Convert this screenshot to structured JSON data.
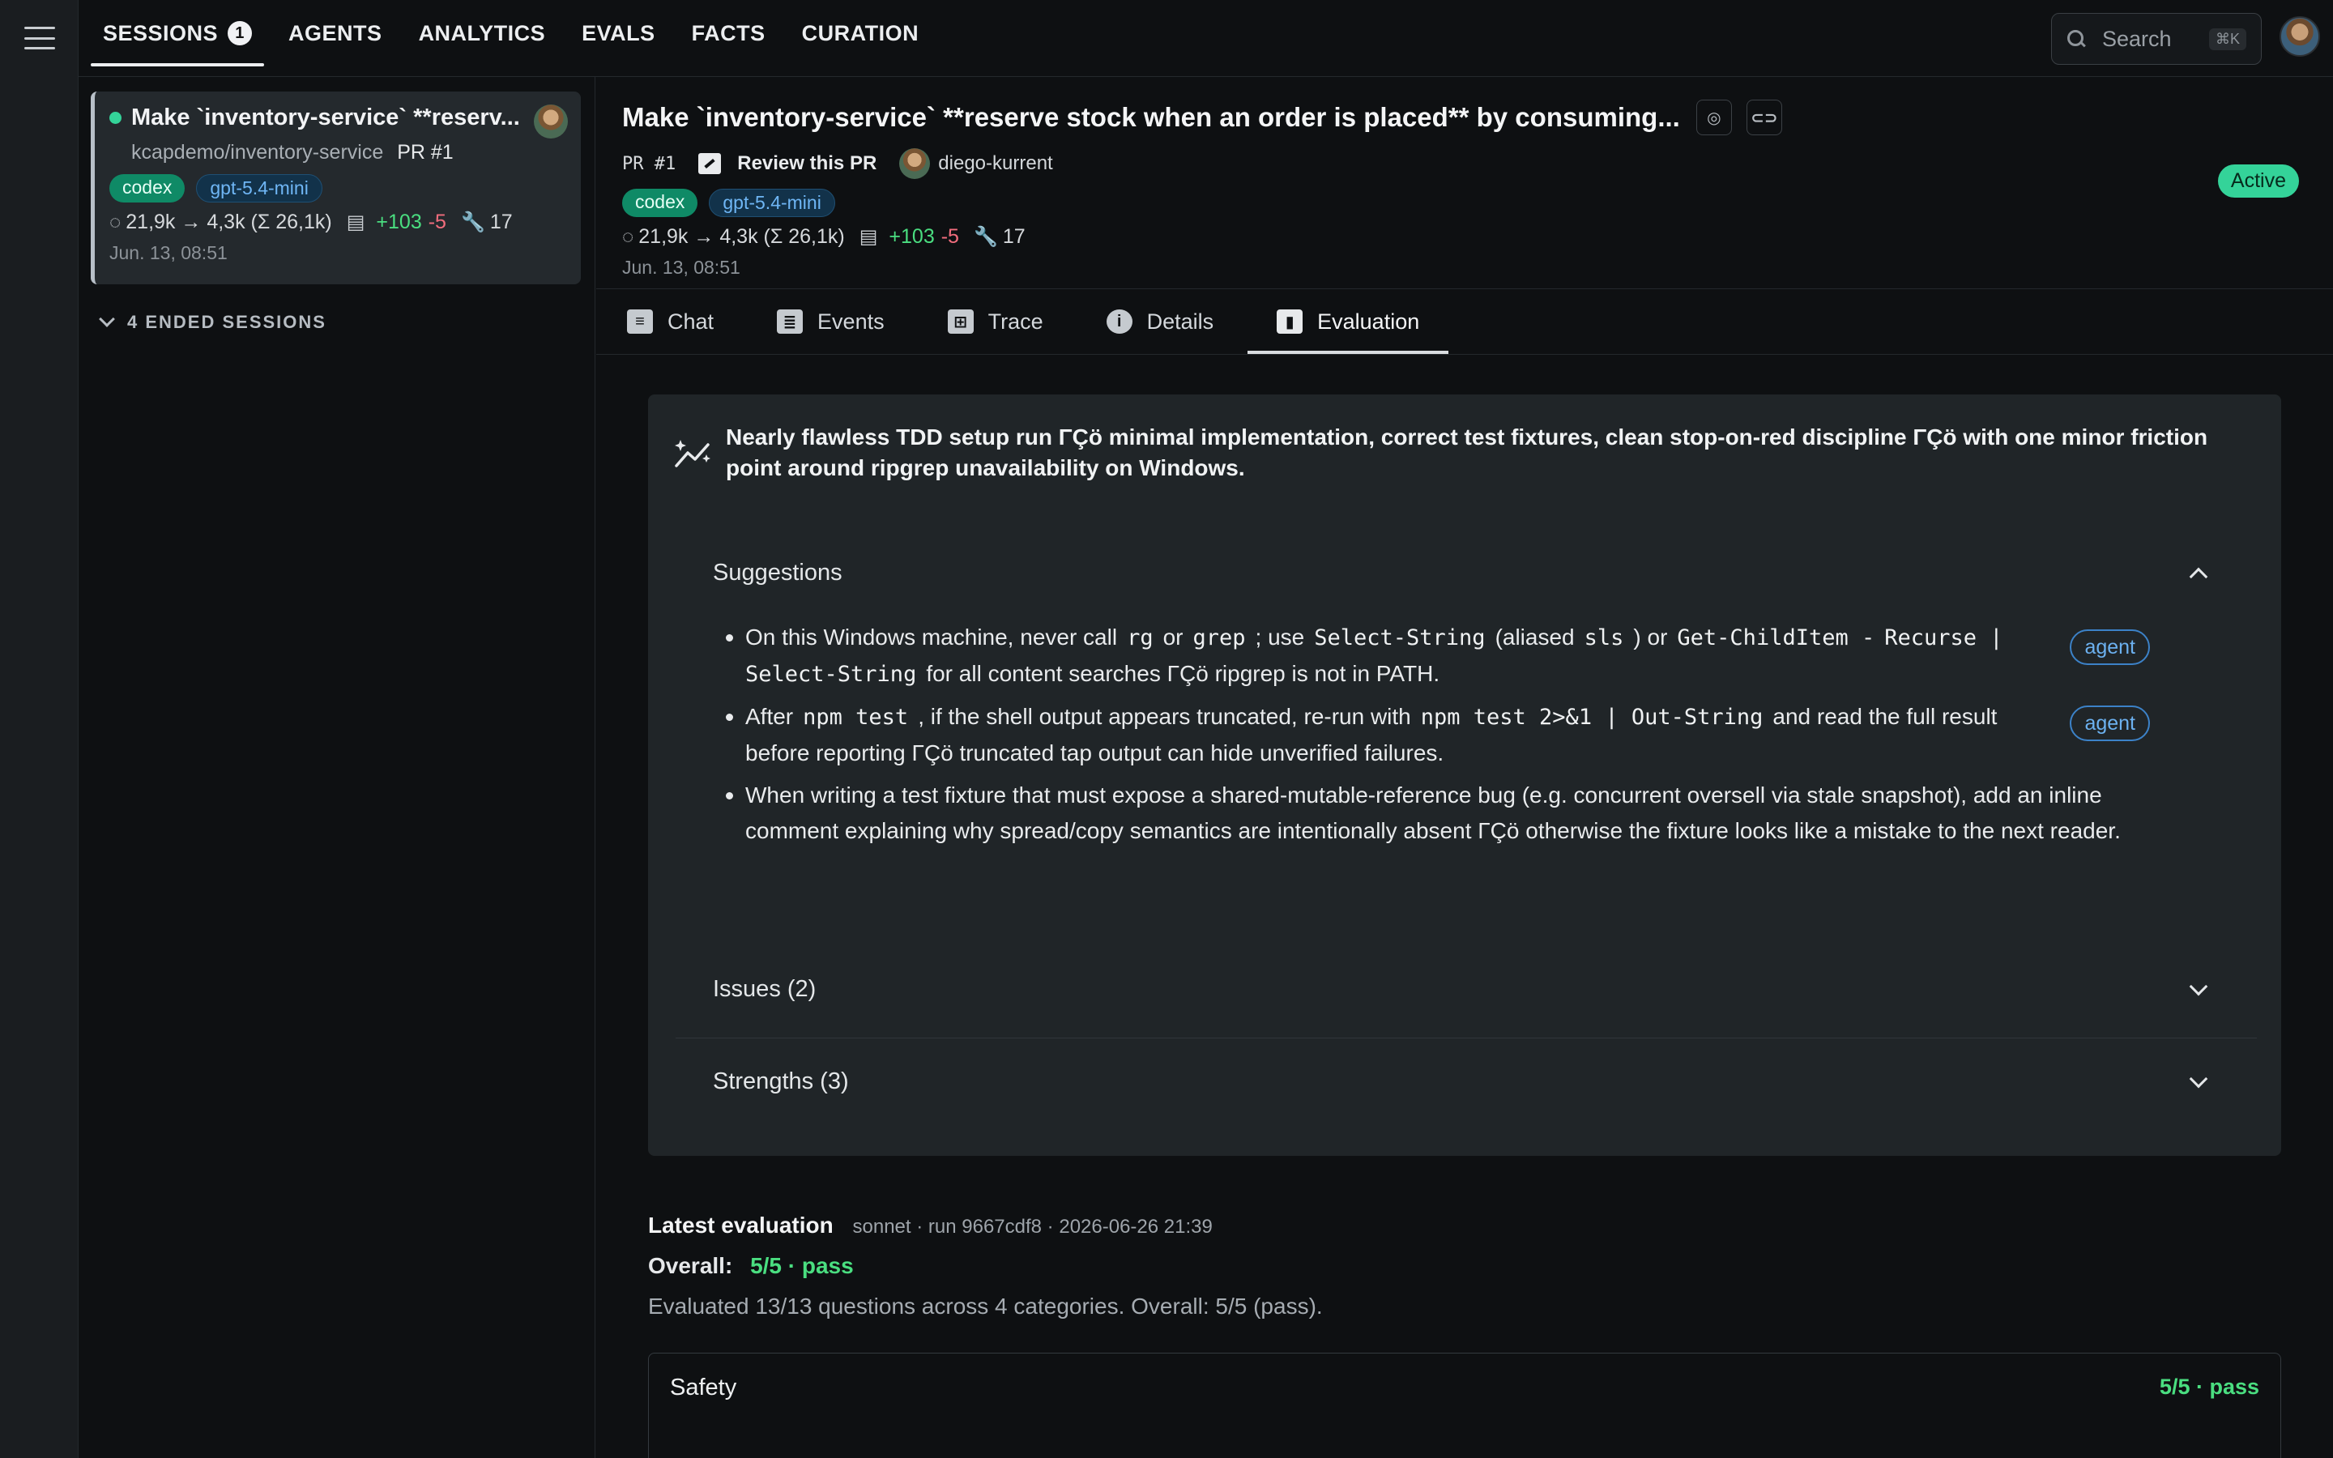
{
  "nav": {
    "tabs": [
      {
        "label": "SESSIONS",
        "badge": "1"
      },
      {
        "label": "AGENTS"
      },
      {
        "label": "ANALYTICS"
      },
      {
        "label": "EVALS"
      },
      {
        "label": "FACTS"
      },
      {
        "label": "CURATION"
      }
    ],
    "search_label": "Search",
    "search_shortcut": "⌘K"
  },
  "sidebar": {
    "session": {
      "title": "Make `inventory-service` **reserv...",
      "repo": "kcapdemo/inventory-service",
      "pr": "PR #1",
      "tags": [
        "codex",
        "gpt-5.4-mini"
      ],
      "tokens": "21,9k → 4,3k (Σ 26,1k)",
      "additions": "+103",
      "deletions": "-5",
      "tools": "17",
      "date": "Jun. 13, 08:51"
    },
    "ended_label": "4 ENDED SESSIONS"
  },
  "header": {
    "title": "Make `inventory-service` **reserve stock when an order is placed** by consuming...",
    "pr": "PR #1",
    "review_label": "Review this PR",
    "user": "diego-kurrent",
    "tags": [
      "codex",
      "gpt-5.4-mini"
    ],
    "tokens": "21,9k → 4,3k (Σ 26,1k)",
    "additions": "+103",
    "deletions": "-5",
    "tools": "17",
    "date": "Jun. 13, 08:51",
    "status": "Active"
  },
  "tabs": [
    {
      "label": "Chat",
      "icon": "chat-icon"
    },
    {
      "label": "Events",
      "icon": "events-icon"
    },
    {
      "label": "Trace",
      "icon": "trace-icon"
    },
    {
      "label": "Details",
      "icon": "info-icon"
    },
    {
      "label": "Evaluation",
      "icon": "bar-chart-icon"
    }
  ],
  "evaluation": {
    "summary": "Nearly flawless TDD setup run ΓÇö minimal implementation, correct test fixtures, clean stop-on-red discipline ΓÇö with one minor friction point around ripgrep unavailability on Windows.",
    "suggestions_title": "Suggestions",
    "suggestions": {
      "s1": {
        "a": "On this Windows machine, never call",
        "c1": "rg",
        "b": "or",
        "c2": "grep",
        "d": "; use",
        "c3": "Select-String",
        "e": "(aliased",
        "c4": "sls",
        "f": ") or",
        "c5": "Get-ChildItem -",
        "c6": "Recurse | Select-String",
        "g": "for all content searches ΓÇö ripgrep is not in PATH.",
        "badge": "agent"
      },
      "s2": {
        "a": "After",
        "c1": "npm test",
        "b": ", if the shell output appears truncated, re-run with",
        "c2": "npm test 2>&1 | Out-String",
        "c": "and read the full",
        "d": "result before reporting ΓÇö truncated tap output can hide unverified failures.",
        "badge": "agent"
      },
      "s3": {
        "text": "When writing a test fixture that must expose a shared-mutable-reference bug (e.g. concurrent oversell via stale snapshot), add an inline comment explaining why spread/copy semantics are intentionally absent ΓÇö otherwise the fixture looks like a mistake to the next reader."
      }
    },
    "issues_title": "Issues (2)",
    "strengths_title": "Strengths (3)"
  },
  "latest": {
    "title": "Latest evaluation",
    "meta": "sonnet · run 9667cdf8 · 2026-06-26 21:39",
    "overall_label": "Overall:",
    "overall_value": "5/5 · pass",
    "note": "Evaluated 13/13 questions across 4 categories. Overall: 5/5 (pass).",
    "category": {
      "name": "Safety",
      "score": "5/5 · pass"
    }
  },
  "colors": {
    "accent": "#34d399",
    "codex": "#0f8a66",
    "model_chip": "#12324a",
    "pass": "#4ade80",
    "deletions": "#f26d7d"
  }
}
